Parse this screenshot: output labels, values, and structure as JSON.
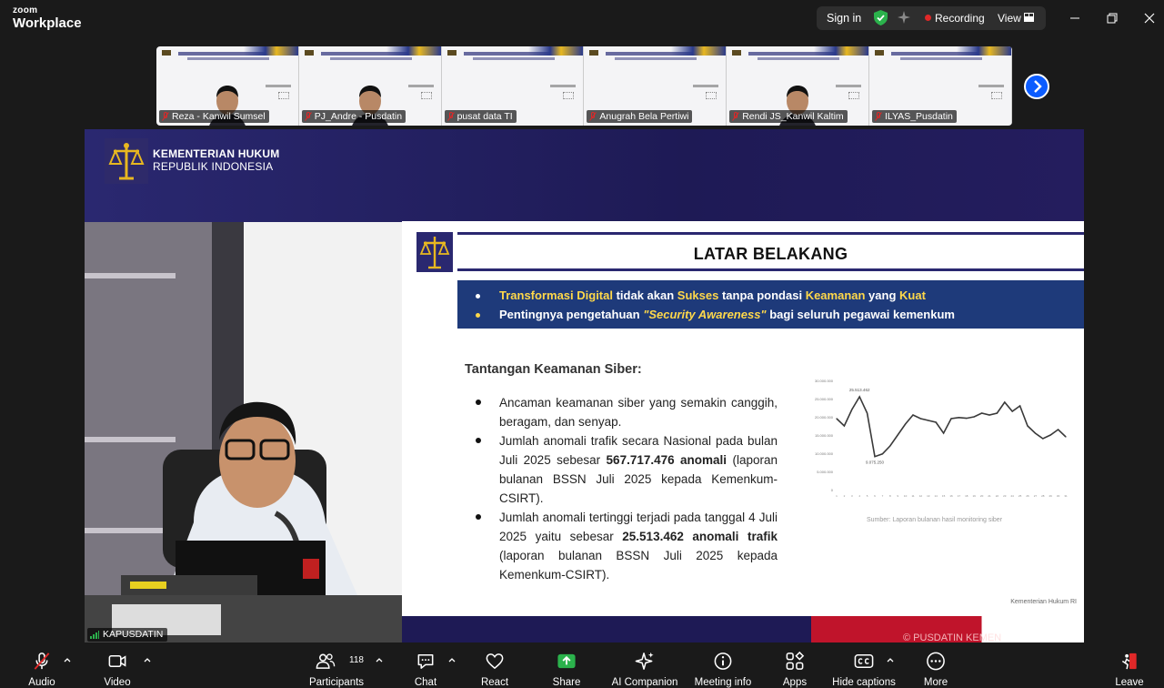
{
  "titlebar": {
    "brand_small": "zoom",
    "brand_big": "Workplace",
    "signin_label": "Sign in",
    "recording_label": "Recording",
    "view_label": "View",
    "colors": {
      "shield": "#2bb24c",
      "recording": "#e02828"
    }
  },
  "gallery": {
    "participants": [
      {
        "name": "Reza - Kanwil Sumsel",
        "has_video": true
      },
      {
        "name": "PJ_Andre - Pusdatin",
        "has_video": true
      },
      {
        "name": "pusat data TI",
        "has_video": false
      },
      {
        "name": "Anugrah Bela Pertiwi",
        "has_video": false
      },
      {
        "name": "Rendi JS_Kanwil Kaltim",
        "has_video": true
      },
      {
        "name": "ILYAS_Pusdatin",
        "has_video": false
      }
    ],
    "next_icon": "chevron-right-icon"
  },
  "share": {
    "ministry_line1": "KEMENTERIAN HUKUM",
    "ministry_line2": "REPUBLIK INDONESIA",
    "slide": {
      "title": "LATAR BELAKANG",
      "box_line1": [
        {
          "t": "Transformasi Digital",
          "hl": true
        },
        {
          "t": " tidak akan ",
          "hl": false
        },
        {
          "t": "Sukses",
          "hl": true
        },
        {
          "t": " tanpa pondasi ",
          "hl": false
        },
        {
          "t": "Keamanan",
          "hl": true
        },
        {
          "t": " yang ",
          "hl": false
        },
        {
          "t": "Kuat",
          "hl": true
        }
      ],
      "box_line2": [
        {
          "t": "Pentingnya pengetahuan ",
          "hl": false
        },
        {
          "t": "\"Security Awareness\"",
          "hl": true
        },
        {
          "t": " bagi seluruh pegawai kemenkum",
          "hl": false
        }
      ],
      "subhead": "Tantangan Keamanan Siber:",
      "items": [
        {
          "parts": [
            {
              "t": "Ancaman keamanan siber yang semakin canggih, beragam, dan senyap.",
              "b": false
            }
          ]
        },
        {
          "parts": [
            {
              "t": "Jumlah anomali trafik secara Nasional pada bulan Juli 2025 sebesar ",
              "b": false
            },
            {
              "t": "567.717.476 anomali",
              "b": true
            },
            {
              "t": " (laporan bulanan BSSN Juli 2025 kepada Kemenkum-CSIRT).",
              "b": false
            }
          ]
        },
        {
          "parts": [
            {
              "t": "Jumlah anomali tertinggi terjadi pada tanggal 4 Juli 2025 yaitu sebesar ",
              "b": false
            },
            {
              "t": "25.513.462 anomali trafik",
              "b": true
            },
            {
              "t": " (laporan bulanan BSSN Juli 2025 kepada Kemenkum-CSIRT).",
              "b": false
            }
          ]
        }
      ],
      "chart_source": "Sumber: Laporan bulanan hasil monitoring siber",
      "footer": "Kementerian Hukum RI"
    },
    "pusdatin_mark": "© PUSDATIN KEMEN",
    "camera_label": "KAPUSDATIN"
  },
  "chart_data": {
    "type": "line",
    "title": "",
    "xlabel": "",
    "ylabel": "",
    "ylim": [
      0,
      30000000
    ],
    "yticks": [
      "0",
      "5.000.000",
      "10.000.000",
      "15.000.000",
      "20.000.000",
      "25.000.000",
      "30.000.000"
    ],
    "x": [
      1,
      2,
      3,
      4,
      5,
      6,
      7,
      8,
      9,
      10,
      11,
      12,
      13,
      14,
      15,
      16,
      17,
      18,
      19,
      20,
      21,
      22,
      23,
      24,
      25,
      26,
      27,
      28,
      29,
      30,
      31
    ],
    "series": [
      {
        "values": [
          19500000,
          17500000,
          22000000,
          25513462,
          21000000,
          9075250,
          9800000,
          12000000,
          15000000,
          18000000,
          20500000,
          19500000,
          19000000,
          18500000,
          15500000,
          19500000,
          19800000,
          19600000,
          20000000,
          21000000,
          20500000,
          21000000,
          24000000,
          21500000,
          23000000,
          17500000,
          15500000,
          14000000,
          15000000,
          16500000,
          14500000
        ]
      }
    ],
    "annotations": [
      {
        "x": 4,
        "y": 25513462,
        "text": "25.513.462"
      },
      {
        "x": 6,
        "y": 9075250,
        "text": "9.075.250"
      }
    ],
    "line_color": "#3a3a3a",
    "grid": false
  },
  "toolbar": {
    "audio": "Audio",
    "video": "Video",
    "participants": "Participants",
    "participant_count": "118",
    "chat": "Chat",
    "react": "React",
    "share": "Share",
    "ai": "AI Companion",
    "meeting_info": "Meeting info",
    "apps": "Apps",
    "captions": "Hide captions",
    "more": "More",
    "leave": "Leave",
    "colors": {
      "share": "#2bb24c",
      "leave": "#e02828",
      "muted": "#e02828"
    }
  }
}
